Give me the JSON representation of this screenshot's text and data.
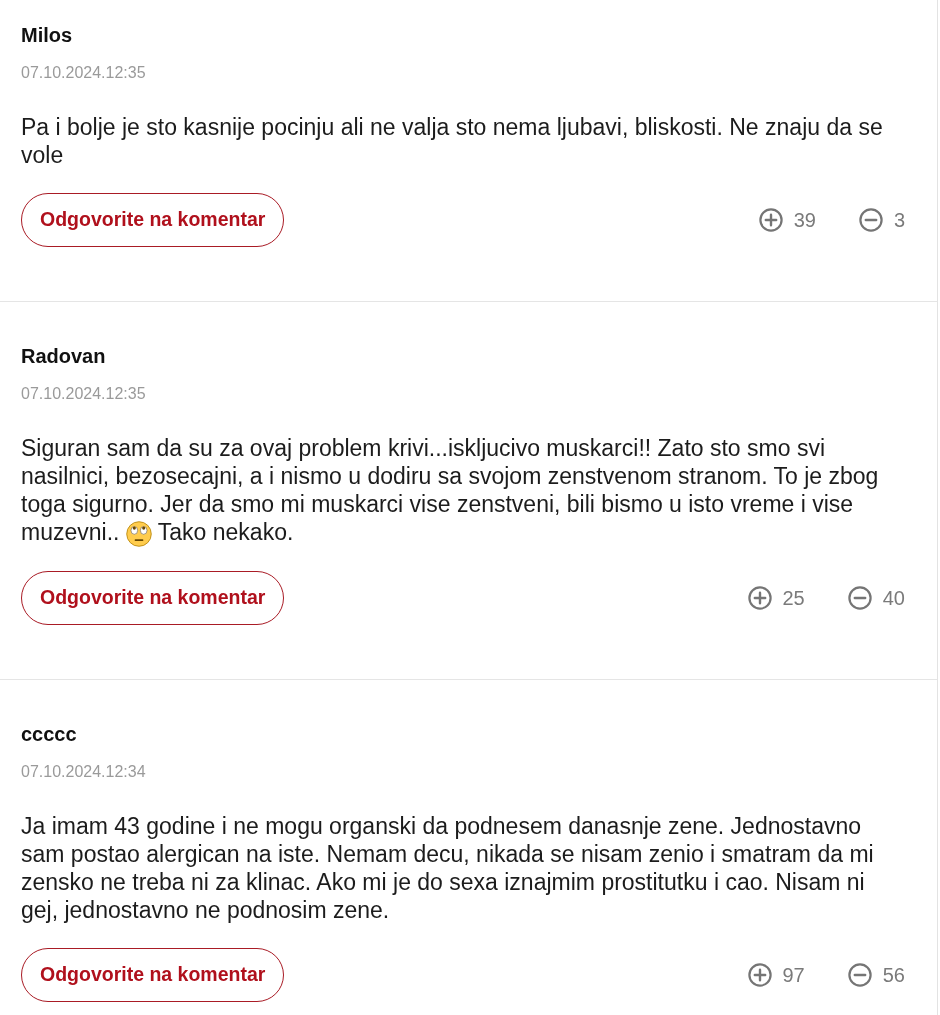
{
  "comments": [
    {
      "author": "Milos",
      "timestamp": "07.10.2024.12:35",
      "body": [
        {
          "kind": "text",
          "text": "Pa i bolje je sto kasnije pocinju ali ne valja sto nema ljubavi, bliskosti. Ne znaju da se vole"
        }
      ],
      "reply_button": "Odgovorite na komentar",
      "upvotes": "39",
      "downvotes": "3"
    },
    {
      "author": "Radovan",
      "timestamp": "07.10.2024.12:35",
      "body": [
        {
          "kind": "text",
          "text": "Siguran sam da su za ovaj problem krivi...iskljucivo muskarci!! Zato sto smo svi nasilnici, bezosecajni, a i nismo u dodiru sa svojom zenstvenom stranom. To je zbog toga sigurno. Jer da smo mi muskarci vise zenstveni, bili bismo u isto vreme i vise muzevni.. "
        },
        {
          "kind": "emoji"
        },
        {
          "kind": "text",
          "text": " Tako nekako."
        }
      ],
      "reply_button": "Odgovorite na komentar",
      "upvotes": "25",
      "downvotes": "40"
    },
    {
      "author": "ccccc",
      "timestamp": "07.10.2024.12:34",
      "body": [
        {
          "kind": "text",
          "text": "Ja imam 43 godine i ne mogu organski da podnesem danasnje zene. Jednostavno sam postao alergican na iste. Nemam decu, nikada se nisam zenio i smatram da mi zensko ne treba ni za klinac. Ako mi je do sexa iznajmim prostitutku i cao. Nisam ni gej, jednostavno ne podnosim zene."
        }
      ],
      "reply_button": "Odgovorite na komentar",
      "upvotes": "97",
      "downvotes": "56"
    }
  ]
}
